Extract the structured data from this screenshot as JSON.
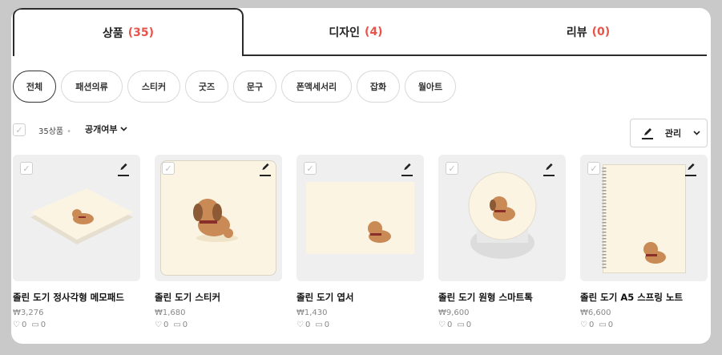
{
  "tabs": [
    {
      "label": "상품",
      "count": "(35)"
    },
    {
      "label": "디자인",
      "count": "(4)"
    },
    {
      "label": "리뷰",
      "count": "(0)"
    }
  ],
  "chips": [
    "전체",
    "패션의류",
    "스티커",
    "굿즈",
    "문구",
    "폰액세서리",
    "잡화",
    "월아트"
  ],
  "controls": {
    "count_label": "35상품",
    "visibility_label": "공개여부",
    "manage_label": "관리"
  },
  "products": [
    {
      "name": "졸린 도기 정사각형 메모패드",
      "price": "₩3,276",
      "likes": "0",
      "comments": "0"
    },
    {
      "name": "졸린 도기 스티커",
      "price": "₩1,680",
      "likes": "0",
      "comments": "0"
    },
    {
      "name": "졸린 도기 엽서",
      "price": "₩1,430",
      "likes": "0",
      "comments": "0"
    },
    {
      "name": "졸린 도기 원형 스마트톡",
      "price": "₩9,600",
      "likes": "0",
      "comments": "0"
    },
    {
      "name": "졸린 도기 A5 스프링 노트",
      "price": "₩6,600",
      "likes": "0",
      "comments": "0"
    }
  ],
  "icons": {
    "check": "check-icon",
    "edit": "pencil-icon",
    "heart": "heart-icon",
    "comment": "comment-icon",
    "chevron": "chevron-down-icon"
  },
  "colors": {
    "accent": "#e8534a",
    "cream": "#fbf4e3",
    "dog": "#c98a55"
  }
}
